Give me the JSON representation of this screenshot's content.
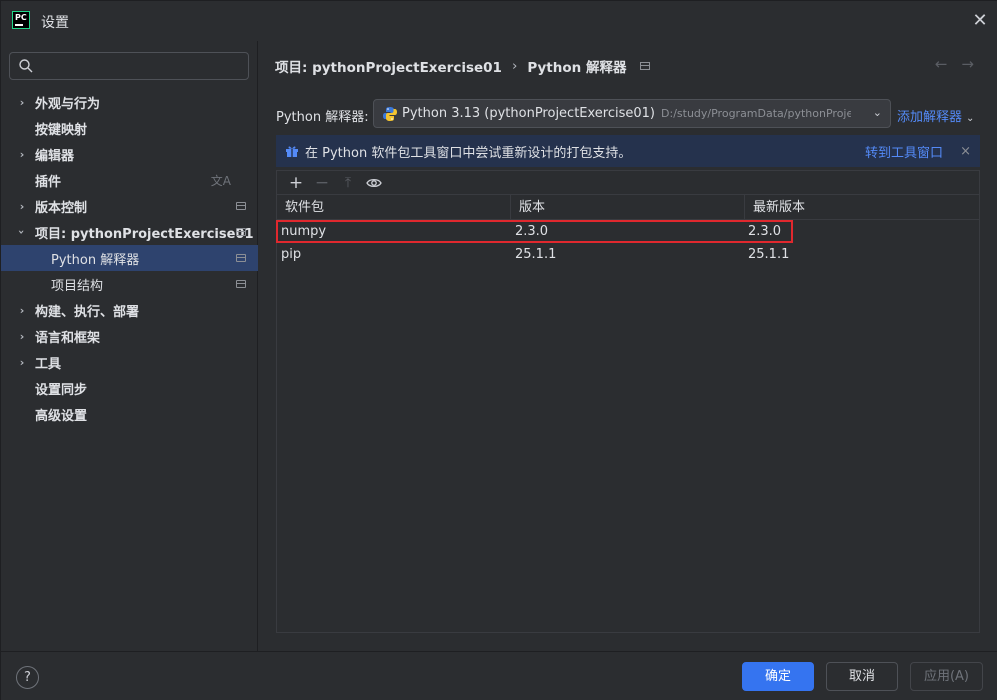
{
  "window": {
    "title": "设置",
    "logo_text": "PC"
  },
  "sidebar": {
    "search_placeholder": "",
    "items": [
      {
        "label": "外观与行为",
        "expandable": true
      },
      {
        "label": "按键映射",
        "expandable": false
      },
      {
        "label": "编辑器",
        "expandable": true
      },
      {
        "label": "插件",
        "expandable": false
      },
      {
        "label": "版本控制",
        "expandable": true
      },
      {
        "label": "项目: pythonProjectExercise01",
        "expandable": true,
        "expanded": true
      },
      {
        "label": "Python 解释器",
        "child": true,
        "selected": true
      },
      {
        "label": "项目结构",
        "child": true
      },
      {
        "label": "构建、执行、部署",
        "expandable": true
      },
      {
        "label": "语言和框架",
        "expandable": true
      },
      {
        "label": "工具",
        "expandable": true
      },
      {
        "label": "设置同步",
        "expandable": false
      },
      {
        "label": "高级设置",
        "expandable": false
      }
    ]
  },
  "breadcrumb": {
    "project": "项目: pythonProjectExercise01",
    "separator": "›",
    "page": "Python 解释器"
  },
  "nav": {
    "back": "←",
    "forward": "→"
  },
  "interpreter": {
    "label": "Python 解释器:",
    "name": "Python 3.13 (pythonProjectExercise01)",
    "path": "D:/study/ProgramData/pythonProjectExer",
    "add_label": "添加解释器"
  },
  "banner": {
    "text": "在 Python 软件包工具窗口中尝试重新设计的打包支持。",
    "link": "转到工具窗口",
    "close": "×"
  },
  "packages": {
    "toolbar": {
      "add": "+",
      "remove": "−",
      "upgrade": "⤒",
      "show": "👁"
    },
    "columns": [
      "软件包",
      "版本",
      "最新版本"
    ],
    "rows": [
      {
        "name": "numpy",
        "version": "2.3.0",
        "latest": "2.3.0",
        "highlighted": true
      },
      {
        "name": "pip",
        "version": "25.1.1",
        "latest": "25.1.1",
        "highlighted": false
      }
    ]
  },
  "footer": {
    "help": "?",
    "ok": "确定",
    "cancel": "取消",
    "apply": "应用(A)"
  },
  "colors": {
    "accent": "#3574f0",
    "link": "#548af7",
    "highlight": "#e0282e",
    "selected": "#2e436e"
  }
}
